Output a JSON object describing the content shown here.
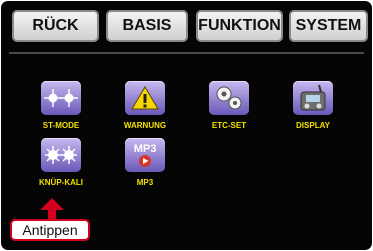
{
  "tabs": {
    "back": "RÜCK",
    "basis": "BASIS",
    "funktion": "FUNKTION",
    "system": "SYSTEM"
  },
  "apps": [
    {
      "label": "ST-MODE",
      "icon": "stick-mode-icon"
    },
    {
      "label": "WARNUNG",
      "icon": "warning-icon"
    },
    {
      "label": "ETC-SET",
      "icon": "gears-icon"
    },
    {
      "label": "DISPLAY",
      "icon": "transmitter-display-icon"
    },
    {
      "label": "KNÜP-KALI",
      "icon": "stick-calibration-icon"
    },
    {
      "label": "MP3",
      "icon": "mp3-player-icon"
    }
  ],
  "callout": {
    "text": "Antippen"
  },
  "colors": {
    "label": "#f3e100",
    "callout_border": "#d2001e",
    "icon_fill": "#8c7ad0"
  }
}
